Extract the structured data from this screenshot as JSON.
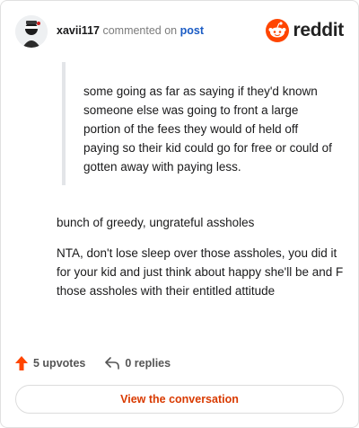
{
  "header": {
    "username": "xavii117",
    "action_text": "commented on",
    "post_link": "post",
    "logo_text": "reddit"
  },
  "comment": {
    "quote": "some going as far as saying if they'd known someone else was going to front a large portion of the fees they would of held off paying so their kid could go for free or could of gotten away with paying less.",
    "paragraphs": [
      "bunch of greedy, ungrateful assholes",
      "NTA, don't lose sleep over those assholes, you did it for your kid and just think about happy she'll be and F those assholes with their entitled attitude"
    ]
  },
  "footer": {
    "upvotes": "5 upvotes",
    "replies": "0 replies",
    "cta_label": "View the conversation"
  },
  "colors": {
    "accent": "#ff4500",
    "link": "#1a5bc4",
    "cta": "#d93a00"
  },
  "icons": {
    "avatar": "avatar-image",
    "logo": "reddit-logo-icon",
    "upvote": "upvote-arrow-icon",
    "reply": "reply-arrow-icon"
  }
}
